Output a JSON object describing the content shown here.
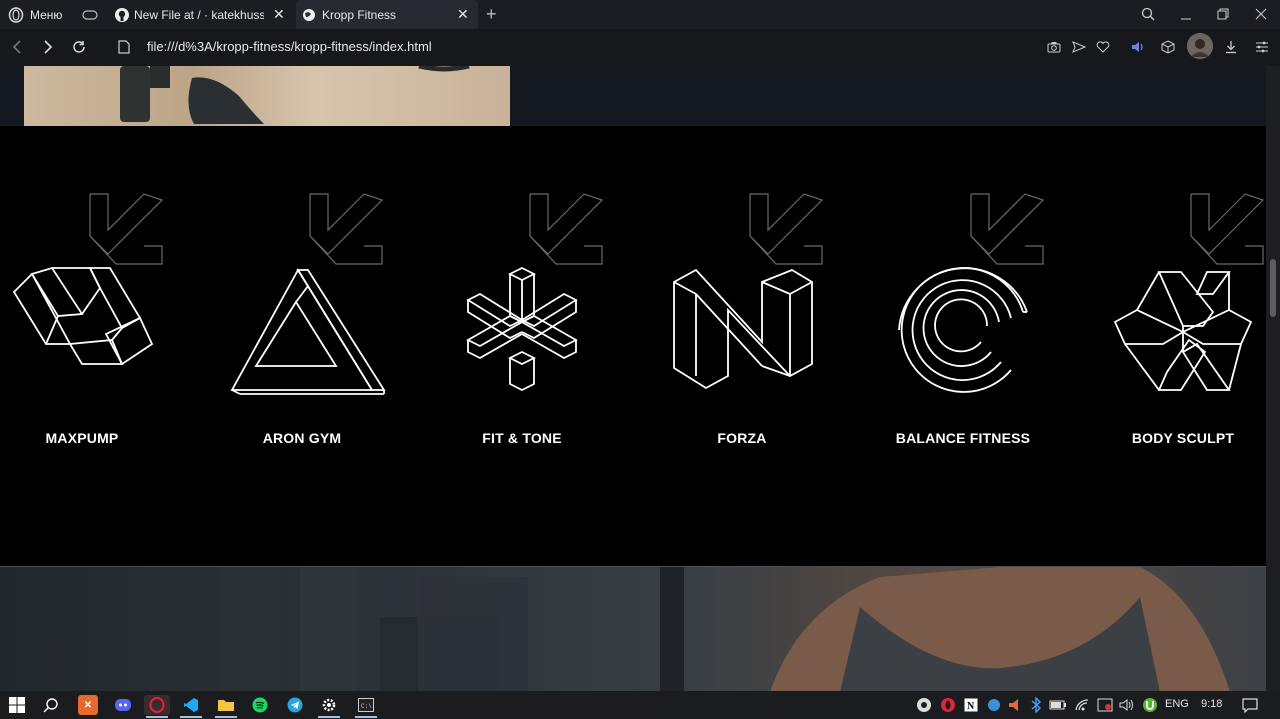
{
  "browser": {
    "menu_label": "Меню",
    "tabs": [
      {
        "title": "New File at / · katekhuss/kr",
        "active": false
      },
      {
        "title": "Kropp Fitness",
        "active": true
      }
    ],
    "new_tab_symbol": "+",
    "url": "file:///d%3A/kropp-fitness/kropp-fitness/index.html"
  },
  "page": {
    "brands": [
      {
        "name": "MAXPUMP",
        "icon": "tri-knot-icon"
      },
      {
        "name": "ARON GYM",
        "icon": "penrose-triangle-icon"
      },
      {
        "name": "FIT & TONE",
        "icon": "asterisk-cube-icon"
      },
      {
        "name": "FORZA",
        "icon": "n-block-icon"
      },
      {
        "name": "BALANCE FITNESS",
        "icon": "concentric-c-icon"
      },
      {
        "name": "BODY SCULPT",
        "icon": "star-cube-icon"
      }
    ]
  },
  "taskbar": {
    "language": "ENG",
    "time": "9:18"
  }
}
